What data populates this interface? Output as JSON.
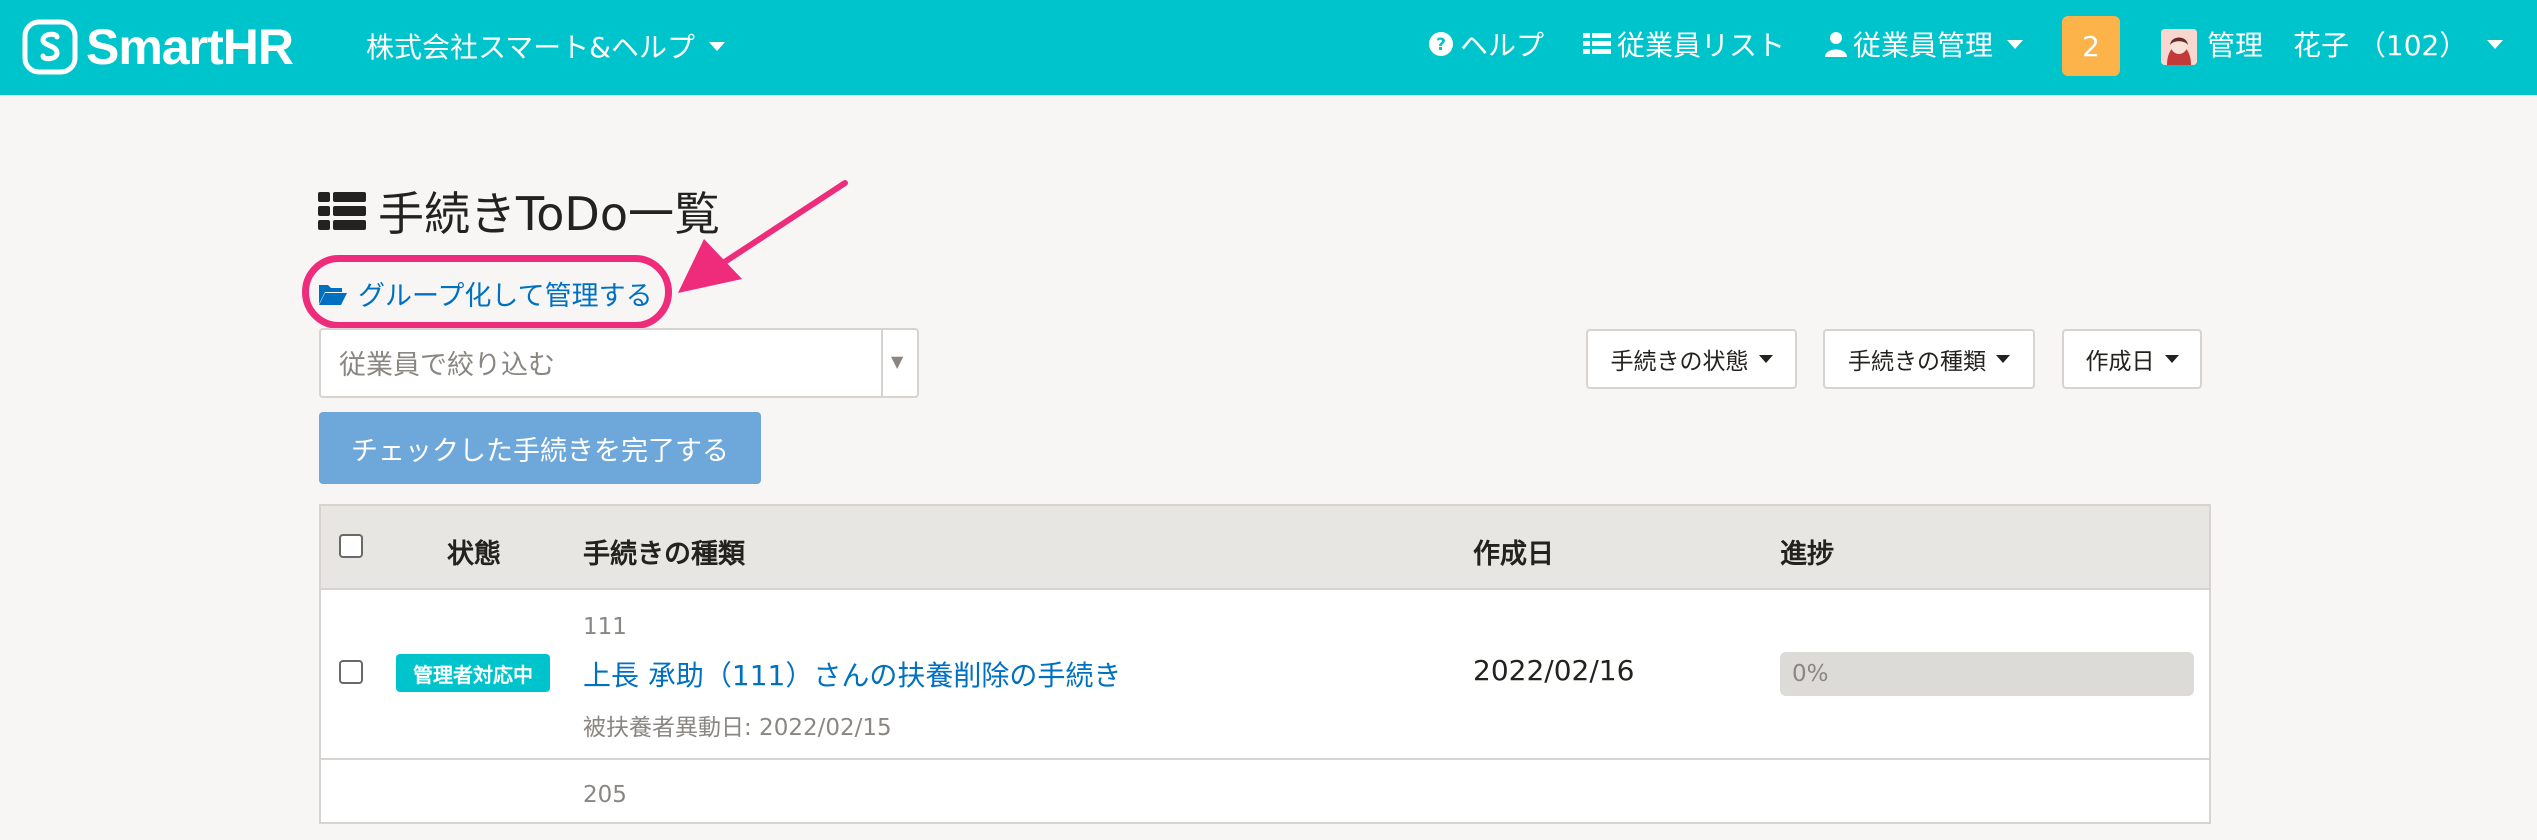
{
  "header": {
    "logo_text": "SmartHR",
    "company": "株式会社スマート&ヘルプ",
    "nav": {
      "help": "ヘルプ",
      "employee_list": "従業員リスト",
      "employee_management": "従業員管理"
    },
    "notification_count": "2",
    "user_role": "管理",
    "user_name": "花子 （102）"
  },
  "page": {
    "title": "手続きToDo一覧",
    "group_link": "グループ化して管理する",
    "filter_placeholder": "従業員で絞り込む",
    "filter_buttons": {
      "status": "手続きの状態",
      "type": "手続きの種類",
      "created": "作成日"
    },
    "complete_button": "チェックした手続きを完了する"
  },
  "table": {
    "headers": {
      "status": "状態",
      "type": "手続きの種類",
      "created": "作成日",
      "progress": "進捗"
    },
    "rows": [
      {
        "id": "111",
        "status": "管理者対応中",
        "title": "上長 承助（111）さんの扶養削除の手続き",
        "sub": "被扶養者異動日: 2022/02/15",
        "created": "2022/02/16",
        "progress_label": "0%",
        "progress": 0
      },
      {
        "id": "205"
      }
    ]
  },
  "colors": {
    "brand": "#00c4cc",
    "highlight": "#ef2b7c",
    "link": "#0071c1",
    "notification": "#fcb34a"
  }
}
